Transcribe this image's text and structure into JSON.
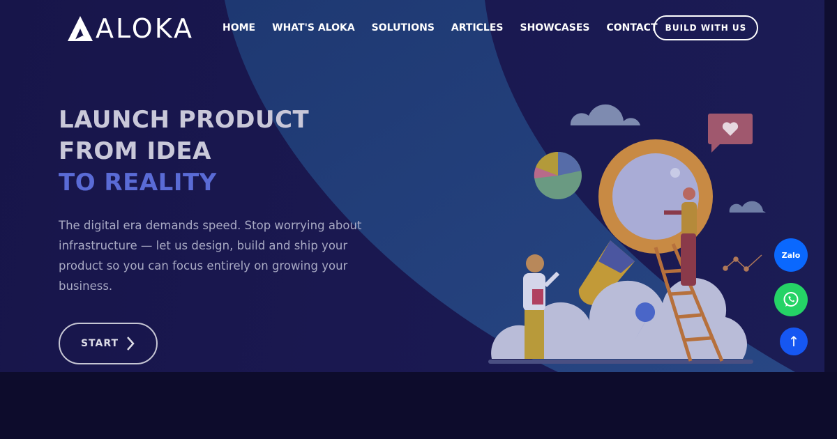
{
  "brand": {
    "name": "ALOKA",
    "logo_icon": "aloka-triangle-logo"
  },
  "nav": {
    "items": [
      {
        "label": "HOME"
      },
      {
        "label": "WHAT'S ALOKA"
      },
      {
        "label": "SOLUTIONS"
      },
      {
        "label": "ARTICLES"
      },
      {
        "label": "SHOWCASES"
      },
      {
        "label": "CONTACT"
      }
    ],
    "cta_label": "BUILD WITH US"
  },
  "hero": {
    "line1": "LAUNCH PRODUCT",
    "line2": "FROM IDEA",
    "line3": "TO REALITY",
    "description": "The digital era demands speed. Stop worrying about infrastructure — let us design, build and ship your product so you can focus entirely on growing your business.",
    "start_label": "START",
    "start_icon": "chevron-right-icon",
    "illustration": "magnifier-ladder-illustration"
  },
  "floating": {
    "zalo_label": "Zalo",
    "whatsapp_icon": "whatsapp-icon",
    "top_label": "↑"
  },
  "colors": {
    "hero_bg": "#1a1850",
    "accent_text": "#5a6bd6",
    "zalo": "#0a68fe",
    "whatsapp": "#25d366",
    "back_to_top": "#1657f2"
  }
}
